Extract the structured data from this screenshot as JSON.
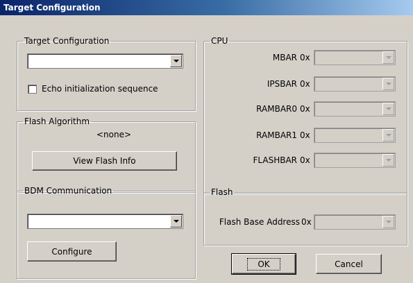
{
  "window": {
    "title": "Target Configuration"
  },
  "target_group": {
    "legend": "Target Configuration",
    "selected": "",
    "echo_label": "Echo initialization sequence",
    "echo_checked": false
  },
  "flash_algo_group": {
    "legend": "Flash Algorithm",
    "value": "<none>",
    "view_button": "View Flash Info"
  },
  "bdm_group": {
    "legend": "BDM Communication",
    "selected": "",
    "configure_button": "Configure"
  },
  "cpu_group": {
    "legend": "CPU",
    "prefix": "0x",
    "registers": [
      {
        "label": "MBAR",
        "value": ""
      },
      {
        "label": "IPSBAR",
        "value": ""
      },
      {
        "label": "RAMBAR0",
        "value": ""
      },
      {
        "label": "RAMBAR1",
        "value": ""
      },
      {
        "label": "FLASHBAR",
        "value": ""
      }
    ]
  },
  "flash_group": {
    "legend": "Flash",
    "base_label": "Flash Base Address",
    "prefix": "0x",
    "value": ""
  },
  "buttons": {
    "ok": "OK",
    "cancel": "Cancel"
  }
}
